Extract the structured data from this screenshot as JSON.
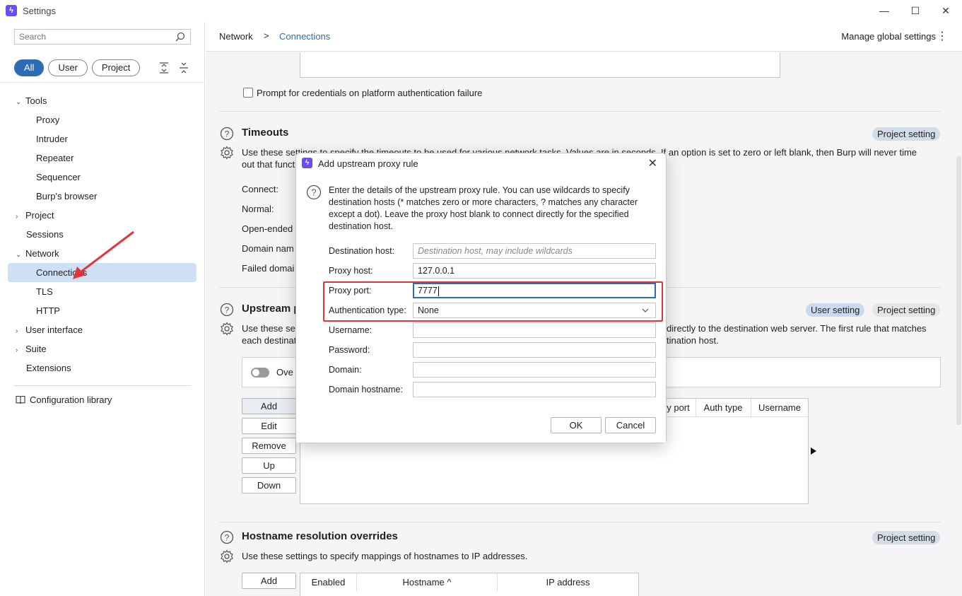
{
  "window": {
    "title": "Settings",
    "minimize": "—",
    "maximize": "☐",
    "close": "✕"
  },
  "sidebar": {
    "search_placeholder": "Search",
    "filters": [
      "All",
      "User",
      "Project"
    ],
    "items": [
      {
        "label": "Tools",
        "chevron": "v"
      },
      {
        "label": "Proxy"
      },
      {
        "label": "Intruder"
      },
      {
        "label": "Repeater"
      },
      {
        "label": "Sequencer"
      },
      {
        "label": "Burp's browser"
      },
      {
        "label": "Project",
        "chevron": ">"
      },
      {
        "label": "Sessions"
      },
      {
        "label": "Network",
        "chevron": "v"
      },
      {
        "label": "Connections"
      },
      {
        "label": "TLS"
      },
      {
        "label": "HTTP"
      },
      {
        "label": "User interface",
        "chevron": ">"
      },
      {
        "label": "Suite",
        "chevron": ">"
      },
      {
        "label": "Extensions"
      }
    ],
    "config_library": "Configuration library"
  },
  "header": {
    "breadcrumb_root": "Network",
    "breadcrumb_sep": ">",
    "breadcrumb_current": "Connections",
    "manage_global": "Manage global settings",
    "kebab": "⋮"
  },
  "content": {
    "prompt_credentials": "Prompt for credentials on platform authentication failure",
    "timeouts": {
      "title": "Timeouts",
      "badge": "Project setting",
      "desc_line1": "Use these settings to specify the timeouts to be used for various network tasks. Values are in seconds. If an option is set to zero or left blank, then Burp will never time",
      "desc_line2": "out that funct",
      "rows": [
        "Connect:",
        "Normal:",
        "Open-ended",
        "Domain nam",
        "Failed domai"
      ]
    },
    "upstream": {
      "title": "Upstream p",
      "badge_user": "User setting",
      "badge_project": "Project setting",
      "desc_line1_left": "Use these set",
      "desc_line1_right": "directly to the destination web server. The first rule that matches",
      "desc_line2_left": "each destinat",
      "desc_line2_right": "tination host.",
      "override_label": "Ove",
      "buttons": [
        "Add",
        "Edit",
        "Remove",
        "Up",
        "Down"
      ],
      "columns": [
        "y port",
        "Auth type",
        "Username"
      ]
    },
    "hostname": {
      "title": "Hostname resolution overrides",
      "badge": "Project setting",
      "desc": "Use these settings to specify mappings of hostnames to IP addresses.",
      "add": "Add",
      "columns": [
        "Enabled",
        "Hostname ^",
        "IP address"
      ]
    }
  },
  "dialog": {
    "title": "Add upstream proxy rule",
    "close": "✕",
    "description": "Enter the details of the upstream proxy rule. You can use wildcards to specify destination hosts (* matches zero or more characters, ? matches any character except a dot). Leave the proxy host blank to connect directly for the specified destination host.",
    "fields": {
      "destination_host_label": "Destination host:",
      "destination_host_placeholder": "Destination host, may include wildcards",
      "proxy_host_label": "Proxy host:",
      "proxy_host_value": "127.0.0.1",
      "proxy_port_label": "Proxy port:",
      "proxy_port_value": "7777",
      "auth_type_label": "Authentication type:",
      "auth_type_value": "None",
      "username_label": "Username:",
      "password_label": "Password:",
      "domain_label": "Domain:",
      "domain_hostname_label": "Domain hostname:"
    },
    "ok": "OK",
    "cancel": "Cancel"
  },
  "colors": {
    "accent": "#2e6db4",
    "highlight": "#e0363b",
    "brand": "#6a4df4"
  }
}
